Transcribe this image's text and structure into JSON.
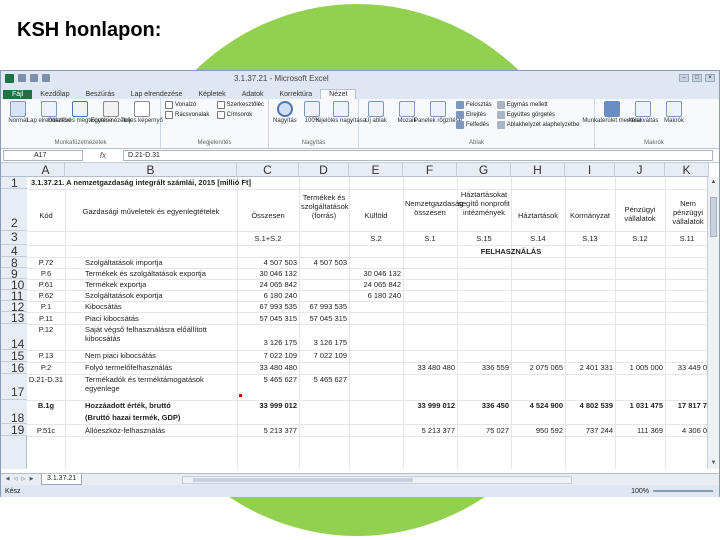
{
  "slide": {
    "title": "KSH honlapon:"
  },
  "window": {
    "title": "3.1.37.21 - Microsoft Excel",
    "controls": [
      "–",
      "□",
      "×"
    ]
  },
  "ribbon": {
    "tabs": [
      "Fájl",
      "Kezdőlap",
      "Beszúrás",
      "Lap elrendezése",
      "Képletek",
      "Adatok",
      "Korrektúra",
      "Nézet"
    ],
    "groups": [
      {
        "name": "Munkafüzetnézetek",
        "buttons": [
          "Normál",
          "Lap elrendezése",
          "Oldaltörés megtekintése",
          "Egyéni nézetek",
          "Teljes képernyő"
        ]
      },
      {
        "name": "Megjelenítés",
        "checks": [
          "Vonalzó",
          "Rácsvonalak",
          "Szerkesztőléc",
          "Címsorok"
        ]
      },
      {
        "name": "Nagyítás",
        "buttons": [
          "Nagyítás",
          "100%",
          "Kijelölés nagyítása"
        ]
      },
      {
        "name": "Ablak",
        "buttons": [
          "Új ablak",
          "Mozaik",
          "Panelek rögzítése"
        ],
        "small": [
          "Felosztás",
          "Elrejtés",
          "Felfedés",
          "Egymás mellett",
          "Együttes görgetés",
          "Ablakhelyzet alaphelyzetbe"
        ]
      },
      {
        "name": "Makrók",
        "buttons": [
          "Munkaterület mentése",
          "Ablakváltás",
          "Makrók"
        ]
      }
    ]
  },
  "formula_bar": {
    "cell_ref": "A17",
    "fx": "fx",
    "content": "D.21-D.31"
  },
  "columns": [
    "A",
    "B",
    "C",
    "D",
    "E",
    "F",
    "G",
    "H",
    "I",
    "J",
    "K"
  ],
  "rows": [
    "1",
    "2",
    "3",
    "4",
    "8",
    "9",
    "10",
    "11",
    "12",
    "13",
    "14",
    "15",
    "16",
    "17",
    "18",
    "19"
  ],
  "sheet": {
    "title": "3.1.37.21. A nemzetgazdaság integrált számlái, 2015 [millió Ft]",
    "header": {
      "kod": "Kód",
      "megnevezes": "Gazdasági műveletek és egyenlegtételek",
      "osszesen": "Összesen",
      "termekek": "Termékek és szolgáltatások (forrás)",
      "kulfold": "Külföld",
      "nemzetgazdasag": "Nemzetgazdaság összesen",
      "haztartasok_nonprofit": "Háztartásokat segítő nonprofit intézmények",
      "haztartasok": "Háztartások",
      "kormanyzat": "Kormányzat",
      "penzugyi": "Pénzügyi vállalatok",
      "nem_penzugyi": "Nem pénzügyi vállalatok"
    },
    "codes_row": {
      "osszesen": "S.1+S.2",
      "kulfold": "S.2",
      "nemzetgazdasag": "S.1",
      "haztartasok_nonprofit": "S.15",
      "haztartasok": "S.14",
      "kormanyzat": "S.13",
      "penzugyi": "S.12",
      "nem_penzugyi": "S.11"
    },
    "felhasznalas": "FELHASZNÁLÁS",
    "data_rows": [
      {
        "kod": "P.72",
        "name": "Szolgáltatások importja",
        "c": "4 507 503",
        "d": "4 507 503",
        "e": "",
        "f": "",
        "g": "",
        "h": "",
        "i": "",
        "j": "",
        "k": ""
      },
      {
        "kod": "P.6",
        "name": "Termékek és szolgáltatások exportja",
        "c": "30 046 132",
        "d": "",
        "e": "30 046 132",
        "f": "",
        "g": "",
        "h": "",
        "i": "",
        "j": "",
        "k": ""
      },
      {
        "kod": "P.61",
        "name": "Termékek exportja",
        "c": "24 065 842",
        "d": "",
        "e": "24 065 842",
        "f": "",
        "g": "",
        "h": "",
        "i": "",
        "j": "",
        "k": ""
      },
      {
        "kod": "P.62",
        "name": "Szolgáltatások exportja",
        "c": "6 180 240",
        "d": "",
        "e": "6 180 240",
        "f": "",
        "g": "",
        "h": "",
        "i": "",
        "j": "",
        "k": ""
      },
      {
        "kod": "P.1",
        "name": "Kibocsátás",
        "c": "67 993 535",
        "d": "67 993 535",
        "e": "",
        "f": "",
        "g": "",
        "h": "",
        "i": "",
        "j": "",
        "k": ""
      },
      {
        "kod": "P.11",
        "name": "Piaci kibocsátás",
        "c": "57 045 315",
        "d": "57 045 315",
        "e": "",
        "f": "",
        "g": "",
        "h": "",
        "i": "",
        "j": "",
        "k": ""
      },
      {
        "kod": "P.12",
        "name": "Saját végső felhasználásra előállított kibocsátás",
        "c": "3 126 175",
        "d": "3 126 175",
        "e": "",
        "f": "",
        "g": "",
        "h": "",
        "i": "",
        "j": "",
        "k": ""
      },
      {
        "kod": "P.13",
        "name": "Nem piaci kibocsátás",
        "c": "7 022 109",
        "d": "7 022 109",
        "e": "",
        "f": "",
        "g": "",
        "h": "",
        "i": "",
        "j": "",
        "k": ""
      },
      {
        "kod": "P.2",
        "name": "Folyó termelőfelhasználás",
        "c": "33 480 480",
        "d": "",
        "e": "",
        "f": "33 480 480",
        "g": "336 559",
        "h": "2 075 065",
        "i": "2 401 331",
        "j": "1 005 000",
        "k": "33 449 0"
      },
      {
        "kod": "D.21-D.31",
        "name": "Termékadók és terméktámogatások egyenlege",
        "c": "5 465 627",
        "d": "5 465 627",
        "e": "",
        "f": "",
        "g": "",
        "h": "",
        "i": "",
        "j": "",
        "k": ""
      },
      {
        "kod": "B.1g",
        "name": "Hozzáadott érték, bruttó",
        "c": "33 999 012",
        "d": "",
        "e": "",
        "f": "33 999 012",
        "g": "336 450",
        "h": "4 524 900",
        "i": "4 802 539",
        "j": "1 031 475",
        "k": "17 817 7",
        "bold": true
      },
      {
        "kod": "",
        "name": "(Bruttó hazai termék, GDP)",
        "c": "",
        "d": "",
        "e": "",
        "f": "",
        "g": "",
        "h": "",
        "i": "",
        "j": "",
        "k": "",
        "bold": true
      },
      {
        "kod": "P.51c",
        "name": "Állóeszköz-felhasználás",
        "c": "5 213 377",
        "d": "",
        "e": "",
        "f": "5 213 377",
        "g": "75 027",
        "h": "950 592",
        "i": "737 244",
        "j": "111 369",
        "k": "4 306 0"
      }
    ]
  },
  "sheet_tab": "3.1.37.21",
  "status": {
    "mode": "Kész",
    "zoom": "100%"
  }
}
